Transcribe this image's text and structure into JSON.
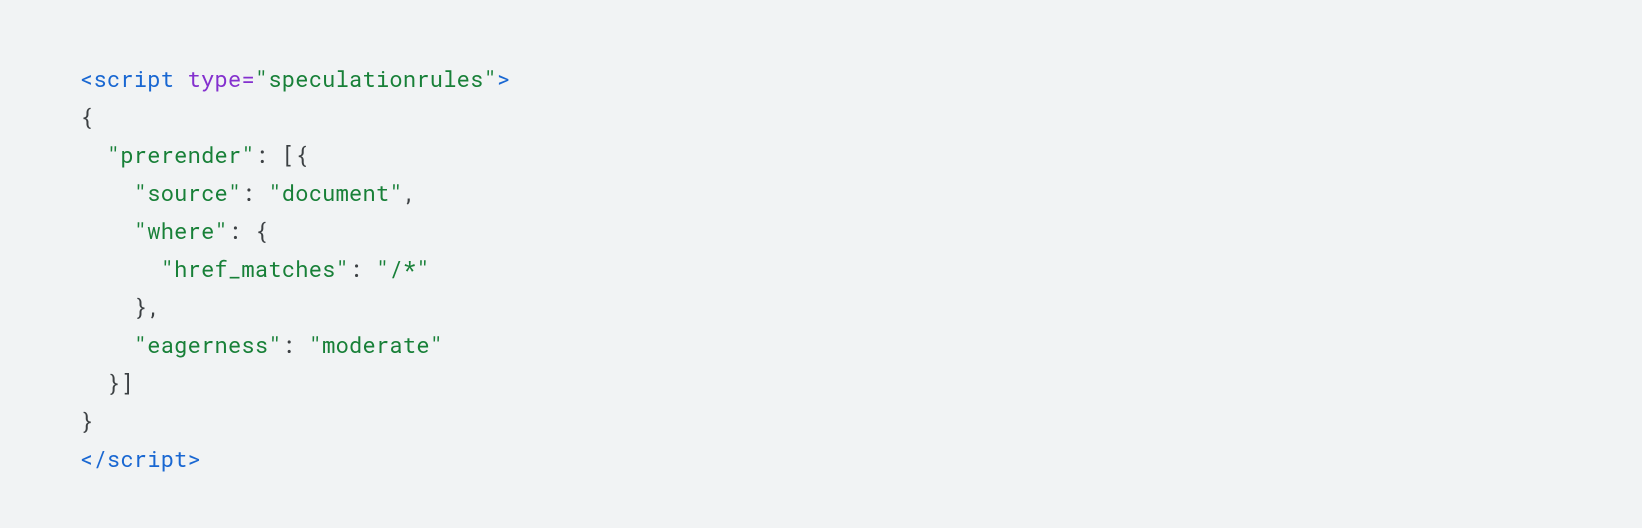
{
  "code": {
    "tag_name": "script",
    "attr_name": "type",
    "attr_value": "\"speculationrules\"",
    "k_prerender": "\"prerender\"",
    "k_source": "\"source\"",
    "v_source": "\"document\"",
    "k_where": "\"where\"",
    "k_href_matches": "\"href_matches\"",
    "v_href_matches": "\"/*\"",
    "k_eagerness": "\"eagerness\"",
    "v_eagerness": "\"moderate\""
  }
}
